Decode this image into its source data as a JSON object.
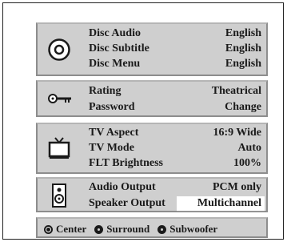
{
  "sections": {
    "disc": {
      "icon": "disc-icon",
      "rows": [
        {
          "label": "Disc Audio",
          "value": "English"
        },
        {
          "label": "Disc Subtitle",
          "value": "English"
        },
        {
          "label": "Disc Menu",
          "value": "English"
        }
      ]
    },
    "security": {
      "icon": "key-icon",
      "rows": [
        {
          "label": "Rating",
          "value": "Theatrical"
        },
        {
          "label": "Password",
          "value": "Change"
        }
      ]
    },
    "tv": {
      "icon": "tv-icon",
      "rows": [
        {
          "label": "TV Aspect",
          "value": "16:9 Wide"
        },
        {
          "label": "TV Mode",
          "value": "Auto"
        },
        {
          "label": "FLT Brightness",
          "value": "100%"
        }
      ]
    },
    "audio": {
      "icon": "speaker-icon",
      "rows": [
        {
          "label": "Audio Output",
          "value": "PCM only"
        },
        {
          "label": "Speaker Output",
          "value": "Multichannel"
        }
      ]
    }
  },
  "speaker_options": [
    {
      "label": "Center",
      "selected": true
    },
    {
      "label": "Surround",
      "selected": false
    },
    {
      "label": "Subwoofer",
      "selected": false
    }
  ],
  "colors": {
    "panel": "#cfcfcf",
    "text": "#1a1a1a",
    "highlight": "#ffffff"
  }
}
